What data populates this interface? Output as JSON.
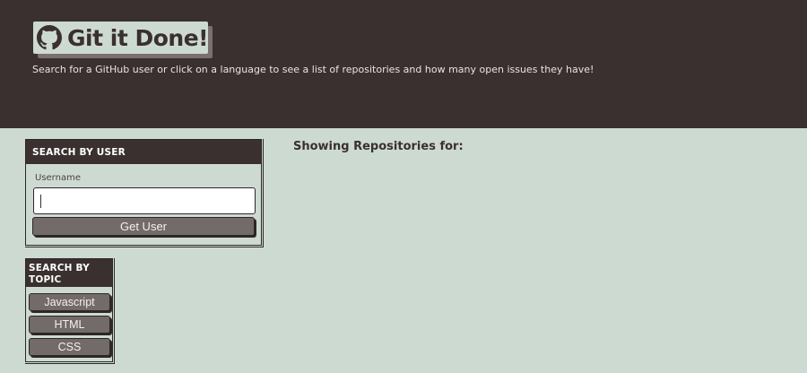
{
  "header": {
    "title": "Git it Done!",
    "logo_icon": "github-icon",
    "tagline": "Search for a GitHub user or click on a language to see a list of repositories and how many open issues they have!"
  },
  "user_search": {
    "heading": "SEARCH BY USER",
    "field_label": "Username",
    "username_value": "",
    "button_label": "Get User"
  },
  "topic_search": {
    "heading": "SEARCH BY TOPIC",
    "topics": [
      "Javascript",
      "HTML",
      "CSS"
    ]
  },
  "repos": {
    "heading": "Showing Repositories for:"
  },
  "colors": {
    "header_bg": "#3a3030",
    "page_bg": "#cddad2",
    "button_bg": "#736a6a"
  }
}
